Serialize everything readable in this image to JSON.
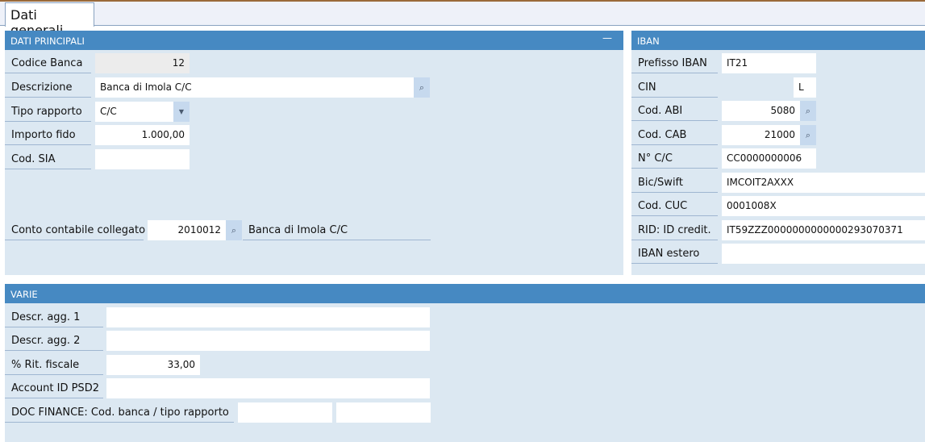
{
  "tab": "Dati generali",
  "principali": {
    "title": "DATI PRINCIPALI",
    "minimize": "—",
    "codice_banca": {
      "label": "Codice Banca",
      "value": "12"
    },
    "descrizione": {
      "label": "Descrizione",
      "value": "Banca di Imola C/C"
    },
    "tipo_rapporto": {
      "label": "Tipo rapporto",
      "value": "C/C"
    },
    "importo_fido": {
      "label": "Importo fido",
      "value": "1.000,00"
    },
    "cod_sia": {
      "label": "Cod. SIA",
      "value": ""
    },
    "conto": {
      "label": "Conto contabile collegato",
      "value": "2010012",
      "description": "Banca di Imola C/C"
    }
  },
  "iban": {
    "title": "IBAN",
    "prefisso": {
      "label": "Prefisso IBAN",
      "value": "IT21"
    },
    "cin": {
      "label": "CIN",
      "value": "L"
    },
    "abi": {
      "label": "Cod. ABI",
      "value": "5080"
    },
    "cab": {
      "label": "Cod. CAB",
      "value": "21000"
    },
    "cc": {
      "label": "N° C/C",
      "value": "CC0000000006"
    },
    "bic": {
      "label": "Bic/Swift",
      "value": "IMCOIT2AXXX"
    },
    "cuc": {
      "label": "Cod. CUC",
      "value": "0001008X"
    },
    "rid": {
      "label": "RID: ID credit.",
      "value": "IT59ZZZ0000000000000293070371"
    },
    "estero": {
      "label": "IBAN estero",
      "value": ""
    }
  },
  "varie": {
    "title": "VARIE",
    "descr1": {
      "label": "Descr. agg. 1",
      "value": ""
    },
    "descr2": {
      "label": "Descr. agg. 2",
      "value": ""
    },
    "rit": {
      "label": "% Rit. fiscale",
      "value": "33,00"
    },
    "psd2": {
      "label": "Account ID PSD2",
      "value": ""
    },
    "doc": {
      "label": "DOC FINANCE: Cod. banca / tipo rapporto",
      "value1": "",
      "value2": ""
    }
  }
}
